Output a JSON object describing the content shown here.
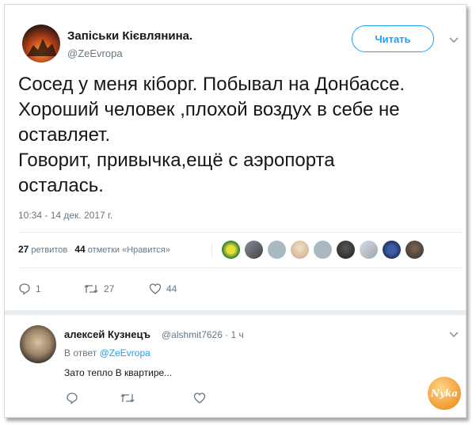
{
  "tweet": {
    "author_name": "Запіськи Кієвлянина.",
    "author_handle": "@ZeEvropa",
    "follow_label": "Читать",
    "text_lines": [
      "Сосед у меня кіборг. Побывал на Донбассе.",
      "Хороший человек ,плохой воздух в себе не",
      "оставляет.",
      "Говорит, привычка,ещё с аэропорта",
      "осталась."
    ],
    "timestamp": "10:34 - 14 дек. 2017 г.",
    "retweets_count": "27",
    "retweets_label": "ретвитов",
    "likes_count": "44",
    "likes_label": "отметки «Нравится»",
    "reply_count": "1",
    "retweet_count": "27",
    "like_count": "44"
  },
  "reply": {
    "author_name": "алексей Кузнецъ",
    "author_handle": "@alshmit7626 · 1 ч",
    "in_reply_prefix": "В ответ",
    "in_reply_handle": "@ZeEvropa",
    "text": "Зато тепло В квартире..."
  },
  "watermark": {
    "text": "Nyka"
  },
  "colors": {
    "accent": "#1da1f2",
    "muted": "#657786",
    "text": "#14171a",
    "divider": "#e6ecf0"
  }
}
